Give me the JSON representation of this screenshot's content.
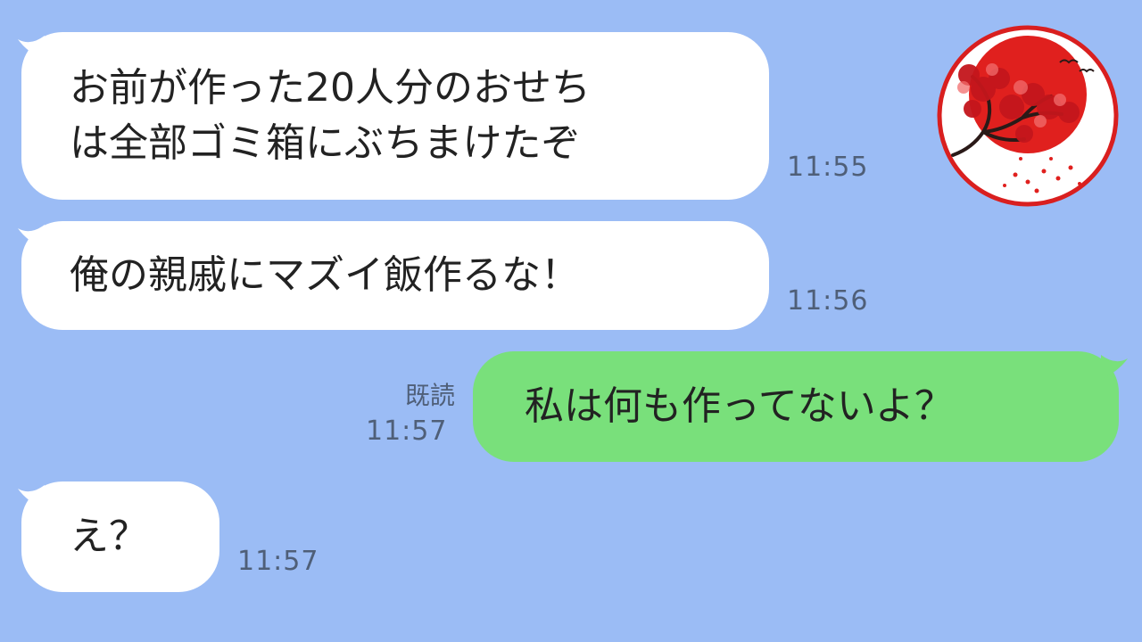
{
  "messages": [
    {
      "side": "in",
      "lines": [
        "お前が作った20人分のおせち",
        "は全部ゴミ箱にぶちまけたぞ"
      ],
      "time": "11:55"
    },
    {
      "side": "in",
      "lines": [
        "俺の親戚にマズイ飯作るな！"
      ],
      "time": "11:56"
    },
    {
      "side": "out",
      "lines": [
        "私は何も作ってないよ？"
      ],
      "read": "既読",
      "time": "11:57"
    },
    {
      "side": "in",
      "lines": [
        "え？"
      ],
      "time": "11:57"
    }
  ],
  "avatar": {
    "icon": "rising-sun-tree-icon",
    "colors": {
      "sun": "#e0201e",
      "ring": "#d91f1f",
      "tree": "#2a1a18"
    }
  },
  "colors": {
    "background": "#9bbcf5",
    "incoming": "#ffffff",
    "outgoing": "#79e07b",
    "time": "#4f5f78"
  }
}
